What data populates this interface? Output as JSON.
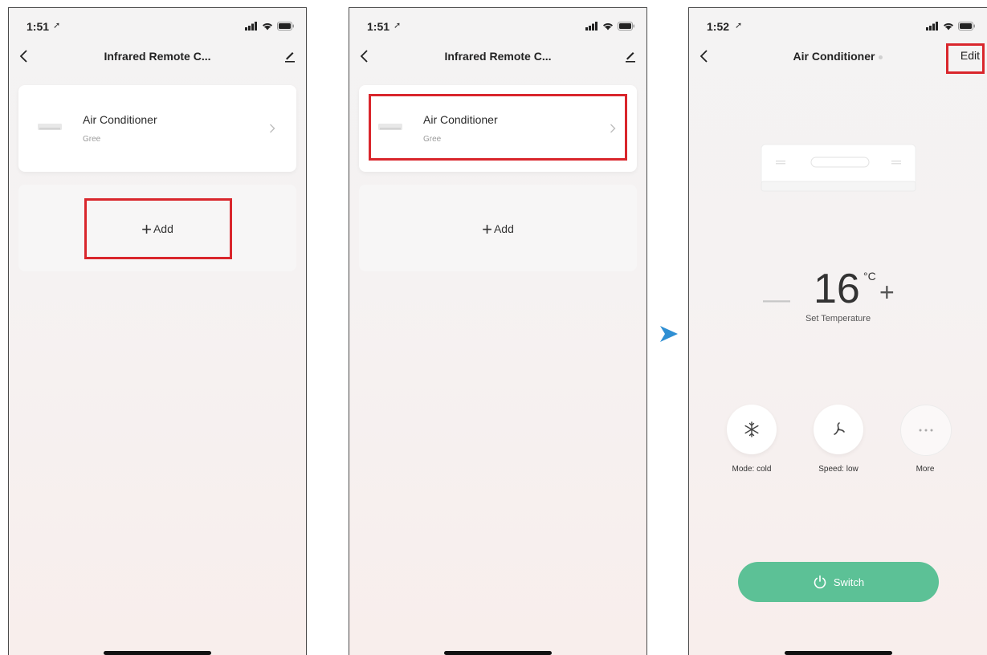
{
  "screens": [
    {
      "time": "1:51",
      "title": "Infrared Remote C...",
      "device": {
        "name": "Air Conditioner",
        "brand": "Gree"
      },
      "add_label": "Add"
    },
    {
      "time": "1:51",
      "title": "Infrared Remote C...",
      "device": {
        "name": "Air Conditioner",
        "brand": "Gree"
      },
      "add_label": "Add"
    },
    {
      "time": "1:52",
      "title": "Air Conditioner",
      "edit_label": "Edit",
      "temperature": {
        "value": "16",
        "unit": "°C",
        "label": "Set Temperature"
      },
      "controls": [
        {
          "label": "Mode: cold",
          "icon": "snowflake-icon"
        },
        {
          "label": "Speed: low",
          "icon": "fan-icon"
        },
        {
          "label": "More",
          "icon": "more-icon"
        }
      ],
      "switch_label": "Switch"
    }
  ],
  "colors": {
    "highlight": "#d9262c",
    "switch": "#5cc196",
    "arrow": "#2f8fd3"
  }
}
